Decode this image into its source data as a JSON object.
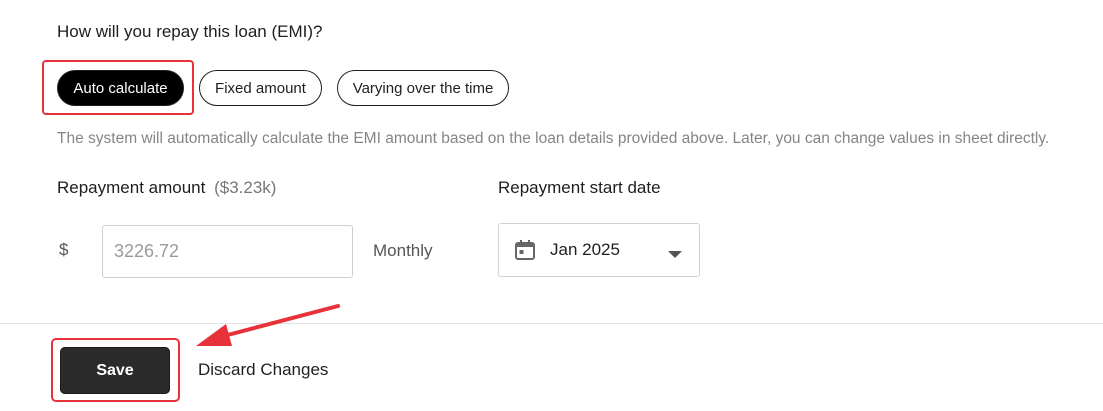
{
  "repay": {
    "question": "How will you repay this loan (EMI)?",
    "options": [
      {
        "label": "Auto calculate",
        "active": true
      },
      {
        "label": "Fixed amount",
        "active": false
      },
      {
        "label": "Varying over the time",
        "active": false
      }
    ],
    "description": "The system will automatically calculate the EMI amount based on the loan details provided above. Later, you can change values in sheet directly."
  },
  "amount": {
    "label": "Repayment amount",
    "summary": "($3.23k)",
    "currency_symbol": "$",
    "placeholder": "3226.72",
    "frequency": "Monthly"
  },
  "start_date": {
    "label": "Repayment start date",
    "value": "Jan 2025"
  },
  "actions": {
    "save_label": "Save",
    "discard_label": "Discard Changes"
  },
  "colors": {
    "annotation": "#e8323a",
    "active_pill": "#000000",
    "save_button": "#2b2b2b"
  },
  "icons": [
    "calendar-icon",
    "caret-down-icon"
  ]
}
